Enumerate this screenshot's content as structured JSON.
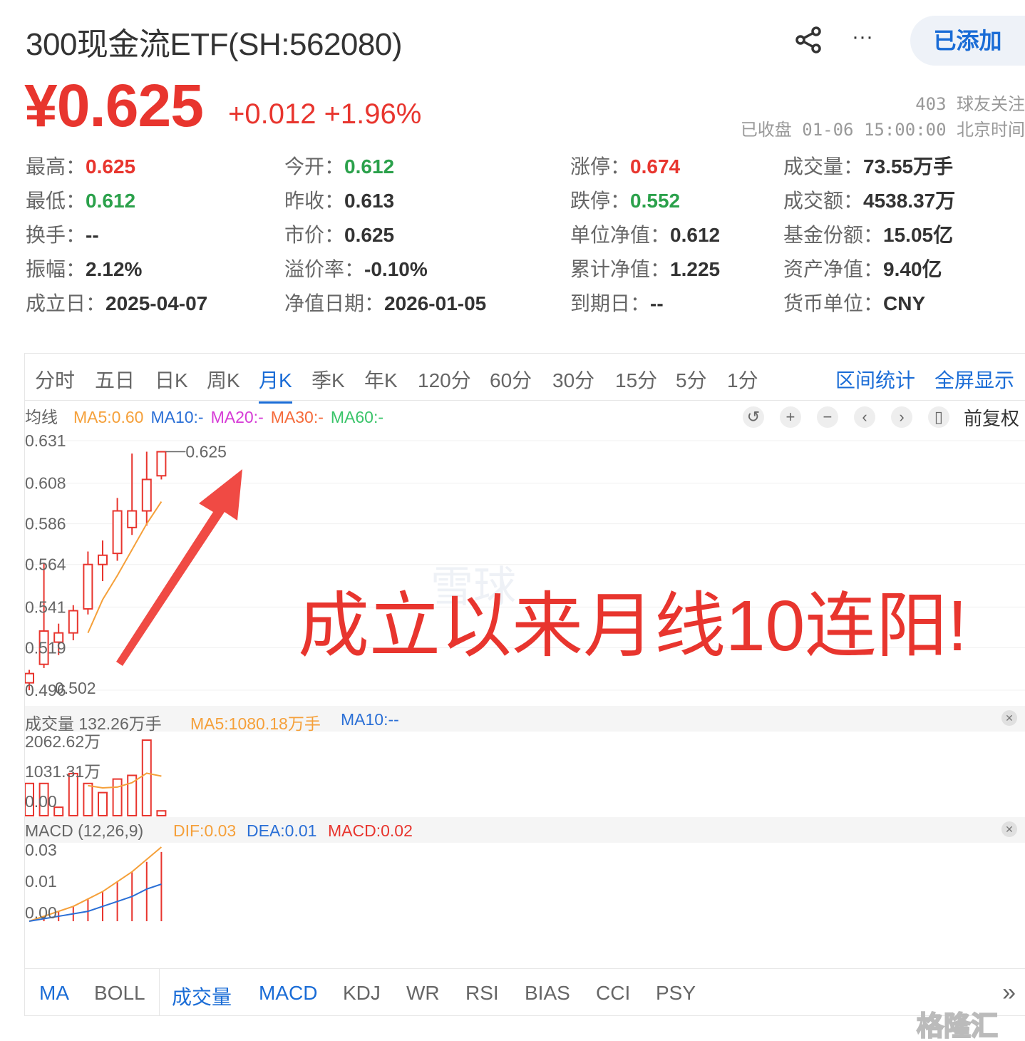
{
  "header": {
    "title": "300现金流ETF(SH:562080)",
    "follow_label": "已添加",
    "more_label": "···"
  },
  "price": {
    "current": "¥0.625",
    "change": "+0.012 +1.96%",
    "followers": "403 球友关注",
    "status_time": "已收盘 01-06 15:00:00 北京时间"
  },
  "stats": [
    {
      "label": "最高：",
      "value": "0.625",
      "tone": "up"
    },
    {
      "label": "今开：",
      "value": "0.612",
      "tone": "down"
    },
    {
      "label": "涨停：",
      "value": "0.674",
      "tone": "up"
    },
    {
      "label": "成交量：",
      "value": "73.55万手",
      "tone": ""
    },
    {
      "label": "最低：",
      "value": "0.612",
      "tone": "down"
    },
    {
      "label": "昨收：",
      "value": "0.613",
      "tone": ""
    },
    {
      "label": "跌停：",
      "value": "0.552",
      "tone": "down"
    },
    {
      "label": "成交额：",
      "value": "4538.37万",
      "tone": ""
    },
    {
      "label": "换手：",
      "value": "--",
      "tone": ""
    },
    {
      "label": "市价：",
      "value": "0.625",
      "tone": ""
    },
    {
      "label": "单位净值：",
      "value": "0.612",
      "tone": ""
    },
    {
      "label": "基金份额：",
      "value": "15.05亿",
      "tone": ""
    },
    {
      "label": "振幅：",
      "value": "2.12%",
      "tone": ""
    },
    {
      "label": "溢价率：",
      "value": "-0.10%",
      "tone": ""
    },
    {
      "label": "累计净值：",
      "value": "1.225",
      "tone": ""
    },
    {
      "label": "资产净值：",
      "value": "9.40亿",
      "tone": ""
    },
    {
      "label": "成立日：",
      "value": "2025-04-07",
      "tone": ""
    },
    {
      "label": "净值日期：",
      "value": "2026-01-05",
      "tone": ""
    },
    {
      "label": "到期日：",
      "value": "--",
      "tone": ""
    },
    {
      "label": "货币单位：",
      "value": "CNY",
      "tone": ""
    }
  ],
  "period_tabs": [
    "分时",
    "五日",
    "日K",
    "周K",
    "月K",
    "季K",
    "年K",
    "120分",
    "60分",
    "30分",
    "15分",
    "5分",
    "1分"
  ],
  "active_tab": "月K",
  "tab_links": [
    "区间统计",
    "全屏显示"
  ],
  "ma_legend": {
    "label": "均线",
    "items": [
      "MA5:0.60",
      "MA10:-",
      "MA20:-",
      "MA30:-",
      "MA60:-"
    ]
  },
  "adjust_label": "前复权",
  "volume": {
    "title": "成交量 132.26万手",
    "ma5": "MA5:1080.18万手",
    "ma10": "MA10:--",
    "y_labels": [
      "2062.62万",
      "1031.31万",
      "0.00"
    ]
  },
  "macd": {
    "title": "MACD (12,26,9)",
    "dif": "DIF:0.03",
    "dea": "DEA:0.01",
    "macd": "MACD:0.02",
    "y_labels": [
      "0.03",
      "0.01",
      "0.00"
    ]
  },
  "indicator_tabs": [
    "MA",
    "BOLL",
    "成交量",
    "MACD",
    "KDJ",
    "WR",
    "RSI",
    "BIAS",
    "CCI",
    "PSY"
  ],
  "annotation": "成立以来月线10连阳!",
  "watermark": "雪球",
  "logo_text": "格隆汇",
  "colors": {
    "up": "#e8352e",
    "down": "#2ba14b",
    "accent": "#1a6cd6",
    "ma5": "#f5a03a",
    "ma10": "#2a6fd6",
    "ma20": "#d63bd6",
    "ma30": "#f56a3a",
    "ma60": "#3ac46a"
  },
  "chart_data": {
    "type": "candlestick",
    "y_labels": [
      "0.631",
      "0.608",
      "0.586",
      "0.564",
      "0.541",
      "0.519",
      "0.496"
    ],
    "ylim": [
      0.496,
      0.631
    ],
    "last_label": "0.625",
    "low_label": "0.502",
    "candles": [
      {
        "o": 0.5,
        "h": 0.507,
        "l": 0.496,
        "c": 0.505
      },
      {
        "o": 0.51,
        "h": 0.565,
        "l": 0.508,
        "c": 0.528
      },
      {
        "o": 0.522,
        "h": 0.532,
        "l": 0.515,
        "c": 0.527
      },
      {
        "o": 0.527,
        "h": 0.542,
        "l": 0.523,
        "c": 0.539
      },
      {
        "o": 0.54,
        "h": 0.571,
        "l": 0.537,
        "c": 0.564
      },
      {
        "o": 0.564,
        "h": 0.577,
        "l": 0.555,
        "c": 0.569
      },
      {
        "o": 0.57,
        "h": 0.6,
        "l": 0.566,
        "c": 0.593
      },
      {
        "o": 0.584,
        "h": 0.624,
        "l": 0.58,
        "c": 0.593
      },
      {
        "o": 0.593,
        "h": 0.625,
        "l": 0.585,
        "c": 0.61
      },
      {
        "o": 0.612,
        "h": 0.625,
        "l": 0.61,
        "c": 0.625
      }
    ],
    "ma5": [
      null,
      null,
      null,
      null,
      0.527,
      0.545,
      0.558,
      0.572,
      0.586,
      0.598
    ],
    "volume_wan": [
      880,
      880,
      230,
      1150,
      880,
      630,
      1000,
      1100,
      2062,
      132
    ],
    "volume_ma5": [
      null,
      null,
      null,
      null,
      820,
      760,
      780,
      900,
      1160,
      1080
    ],
    "dif": [
      0.0,
      0.002,
      0.004,
      0.006,
      0.009,
      0.012,
      0.016,
      0.02,
      0.025,
      0.03
    ],
    "dea": [
      0.0,
      0.001,
      0.002,
      0.003,
      0.004,
      0.006,
      0.008,
      0.01,
      0.013,
      0.015
    ],
    "macd_bar": [
      0.0,
      0.002,
      0.004,
      0.006,
      0.009,
      0.012,
      0.016,
      0.02,
      0.024,
      0.028
    ],
    "macd_ylim": [
      0.0,
      0.03
    ]
  }
}
